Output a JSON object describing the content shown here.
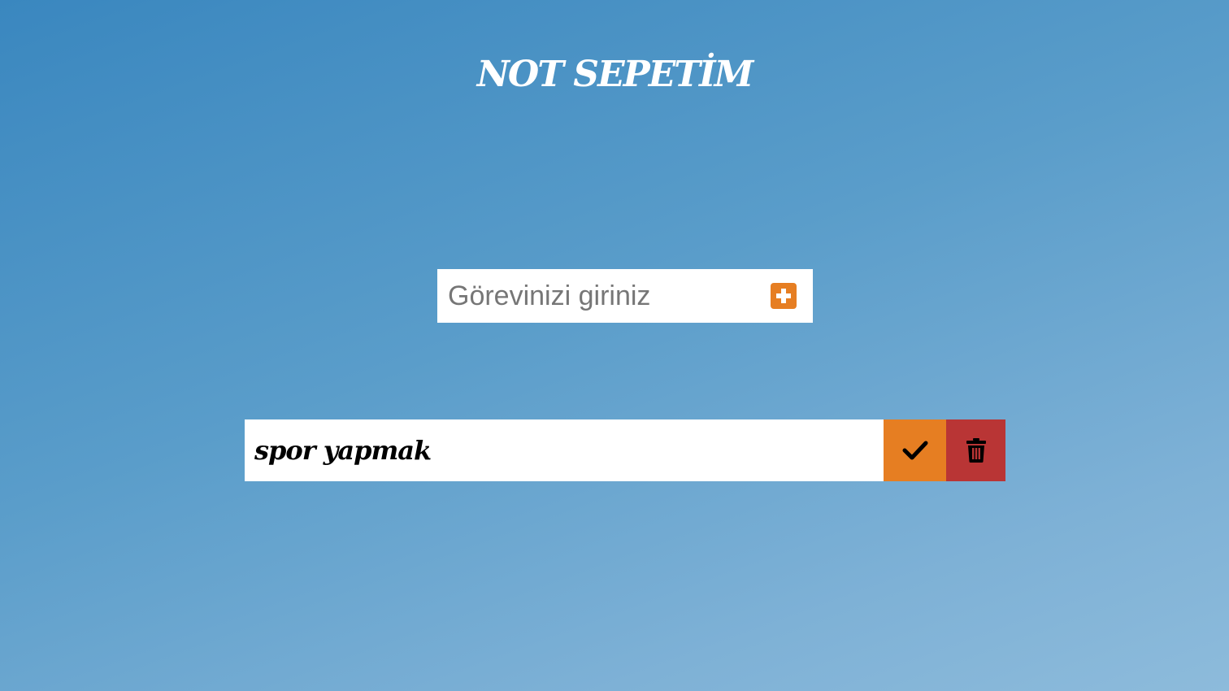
{
  "header": {
    "title": "NOT SEPETİM"
  },
  "form": {
    "placeholder": "Görevinizi giriniz",
    "add_icon": "plus-square-icon"
  },
  "todos": [
    {
      "text": "spor yapmak",
      "complete_icon": "check-icon",
      "delete_icon": "trash-icon"
    }
  ],
  "colors": {
    "background_start": "#3a87bf",
    "background_end": "#8dbbdb",
    "accent": "#e67e22",
    "danger": "#b93535"
  }
}
